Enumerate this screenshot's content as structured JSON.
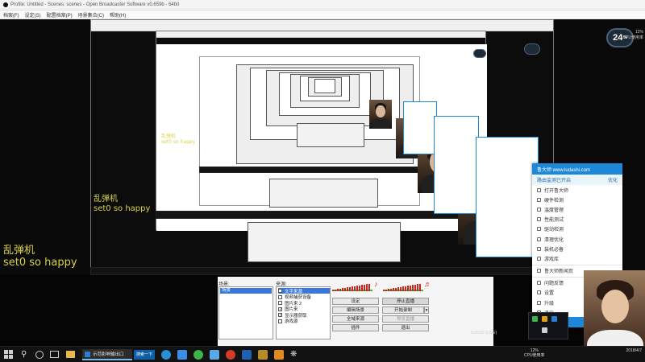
{
  "window": {
    "title": "Profile: Untitled - Scenes: scenes - Open Broadcaster Software v0.659b - 64bit",
    "menu": [
      "档案(F)",
      "设定(S)",
      "配置档案(P)",
      "场景集合(C)",
      "帮助(H)"
    ]
  },
  "overlay": {
    "small_cn": "乱弹机",
    "small_en": "set0 so happy",
    "mid_cn": "乱弹机",
    "mid_en": "set0 so happy",
    "large_cn": "乱弹机",
    "large_en": "set0 so happy"
  },
  "cpu_widget": {
    "value": "24",
    "unit": "%",
    "side_line1": "12%",
    "side_line2": "CPU使用率"
  },
  "popup_menu": {
    "header": "鲁大师 www.ludashi.com",
    "subheader": "路由监测已开启",
    "subheader_action": "优化",
    "items": [
      {
        "icon": "open-icon",
        "label": "打开鲁大师"
      },
      {
        "icon": "hardware-icon",
        "label": "硬件检测"
      },
      {
        "icon": "temp-icon",
        "label": "温度管理"
      },
      {
        "icon": "perf-icon",
        "label": "性能测试"
      },
      {
        "icon": "driver-icon",
        "label": "驱动检测"
      },
      {
        "icon": "clean-icon",
        "label": "清理优化"
      },
      {
        "icon": "phone-icon",
        "label": "装机必备"
      },
      {
        "icon": "game-icon",
        "label": "游戏库"
      },
      {
        "icon": "web-icon",
        "label": "鲁大师新闻页"
      },
      {
        "icon": "feedback-icon",
        "label": "问题反馈"
      },
      {
        "icon": "settings-icon",
        "label": "设置"
      },
      {
        "icon": "upgrade-icon",
        "label": "升级"
      },
      {
        "icon": "exit-icon",
        "label": "退出"
      },
      {
        "icon": "mode-icon",
        "label": "悬浮窗模式"
      }
    ],
    "selected_index": 13
  },
  "dock": {
    "scenes_label": "场景:",
    "sources_label": "来源:",
    "scene_selected": "场景",
    "sources": [
      {
        "label": "文字来源",
        "checked": true,
        "selected": true
      },
      {
        "label": "视频捕获设备",
        "checked": false,
        "selected": false
      },
      {
        "label": "图片来 2",
        "checked": false,
        "selected": false
      },
      {
        "label": "图片来",
        "checked": true,
        "selected": false
      },
      {
        "label": "显示器获取",
        "checked": true,
        "selected": false
      },
      {
        "label": "游戏源",
        "checked": false,
        "selected": false
      }
    ],
    "buttons": {
      "settings": "设定",
      "stop_stream": "停止直播",
      "edit_scene": "编辑场景",
      "start_record": "开始录制",
      "global_sources": "全域来源",
      "preview_stream": "预览直播",
      "plugins": "插件",
      "exit": "退出"
    },
    "status": "0:00:02 (LIVE)"
  },
  "taskbar": {
    "active_app": "示范影响输出口",
    "search_hint": "搜索一下",
    "clock_line1": "12%",
    "clock_line2": "CPU使用率",
    "time": "2018/4/7"
  },
  "colors": {
    "accent": "#1e88d8",
    "meter_red": "#c4261d",
    "meter_green": "#39b54a",
    "overlay_yellow": "#d9d24a"
  }
}
